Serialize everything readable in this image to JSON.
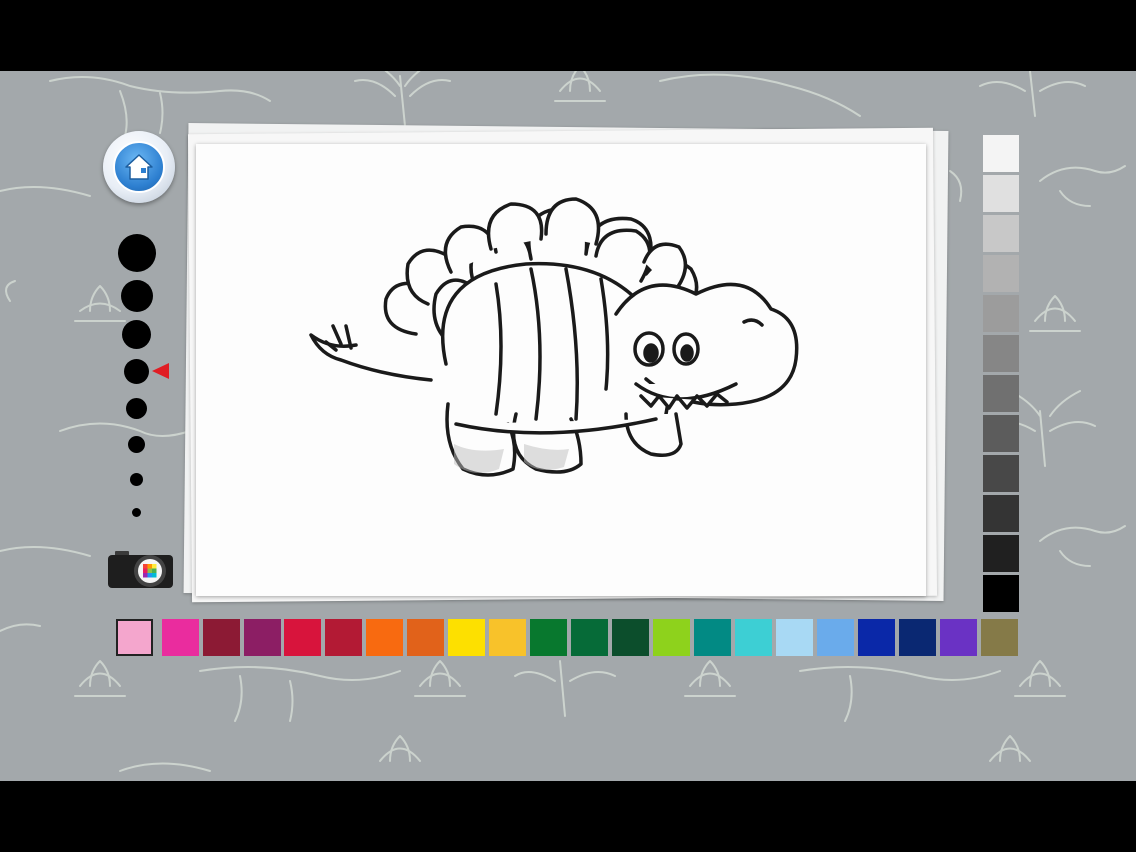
{
  "app": {
    "name": "dinosaur-coloring-app"
  },
  "toolbar": {
    "home_icon": "home-icon",
    "camera_icon": "camera-icon",
    "selected_brush_index": 3,
    "brush_sizes": [
      "extra-large",
      "large",
      "medium-large",
      "medium",
      "medium-small",
      "small",
      "extra-small",
      "tiny"
    ]
  },
  "canvas": {
    "drawing": "stegosaurus-line-art"
  },
  "palette": {
    "selected_color": "#f4a6cd",
    "colors": [
      "#f4a6cd",
      "#ea2c9e",
      "#8c1a34",
      "#8c1e64",
      "#d8143c",
      "#b31a34",
      "#f86a10",
      "#e1621a",
      "#fde000",
      "#f8c22a",
      "#08782e",
      "#066b38",
      "#0c4e2c",
      "#8ed21c",
      "#028a84",
      "#3dcfd4",
      "#a8d9f4",
      "#6aabeb",
      "#0a28a8",
      "#0a2872",
      "#6a32c4",
      "#857a48"
    ],
    "grays": [
      "#f4f4f4",
      "#e0e0e0",
      "#c8c8c8",
      "#b2b2b2",
      "#9c9c9c",
      "#868686",
      "#707070",
      "#5c5c5c",
      "#484848",
      "#343434",
      "#202020",
      "#000000"
    ]
  }
}
